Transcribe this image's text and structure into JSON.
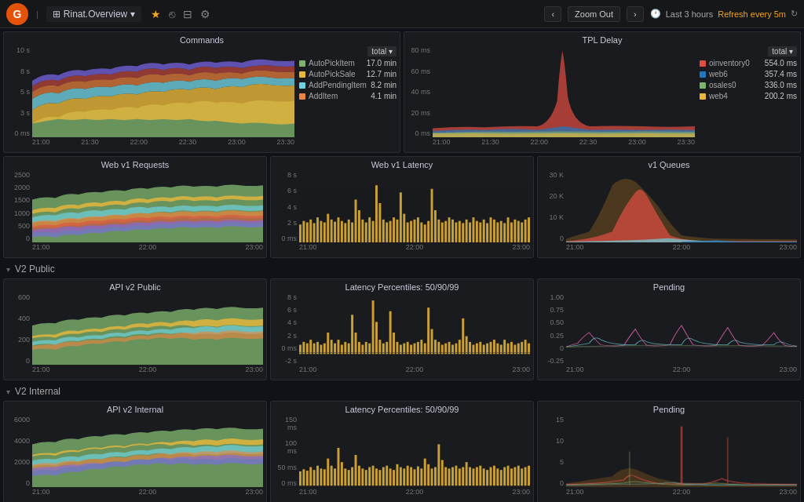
{
  "topnav": {
    "logo": "G",
    "dashboard_icon": "⊞",
    "dashboard_name": "Rinat.Overview",
    "dashboard_chevron": "▾",
    "star_icon": "★",
    "share_icon": "⎋",
    "save_icon": "💾",
    "settings_icon": "⚙",
    "nav_prev": "‹",
    "nav_next": "›",
    "zoom_out_label": "Zoom Out",
    "time_icon": "🕐",
    "time_label": "Last 3 hours",
    "refresh_label": "Refresh every 5m",
    "refresh_icon": "↻"
  },
  "sections": {
    "v2_public_label": "V2 Public",
    "v2_internal_label": "V2 Internal"
  },
  "panels": {
    "commands": {
      "title": "Commands",
      "legend_header": "total ▾",
      "items": [
        {
          "color": "#7eb26d",
          "name": "AutoPickItem",
          "val": "17.0 min"
        },
        {
          "color": "#eab839",
          "name": "AutoPickSale",
          "val": "12.7 min"
        },
        {
          "color": "#6ed0e0",
          "name": "AddPendingItem",
          "val": "8.2 min"
        },
        {
          "color": "#ef843c",
          "name": "AddItem",
          "val": "4.1 min"
        }
      ],
      "yaxis": [
        "10 s",
        "8 s",
        "5 s",
        "3 s",
        "0 ms"
      ],
      "xaxis": [
        "21:00",
        "21:30",
        "22:00",
        "22:30",
        "23:00",
        "23:30"
      ]
    },
    "tpl_delay": {
      "title": "TPL Delay",
      "legend_header": "total ▾",
      "items": [
        {
          "color": "#e24d42",
          "name": "oinventory0",
          "val": "554.0 ms"
        },
        {
          "color": "#1f78c1",
          "name": "web6",
          "val": "357.4 ms"
        },
        {
          "color": "#7eb26d",
          "name": "osales0",
          "val": "336.0 ms"
        },
        {
          "color": "#eab839",
          "name": "web4",
          "val": "200.2 ms"
        }
      ],
      "yaxis": [
        "80 ms",
        "60 ms",
        "40 ms",
        "20 ms",
        "0 ms"
      ],
      "xaxis": [
        "21:00",
        "21:30",
        "22:00",
        "22:30",
        "23:00",
        "23:30"
      ]
    },
    "web_v1_requests": {
      "title": "Web v1 Requests",
      "yaxis": [
        "2500",
        "2000",
        "1500",
        "1000",
        "500",
        "0"
      ],
      "xaxis": [
        "21:00",
        "22:00",
        "23:00"
      ]
    },
    "web_v1_latency": {
      "title": "Web v1 Latency",
      "yaxis": [
        "8 s",
        "6 s",
        "4 s",
        "2 s",
        "0 ms"
      ],
      "xaxis": [
        "21:00",
        "22:00",
        "23:00"
      ]
    },
    "v1_queues": {
      "title": "v1 Queues",
      "yaxis": [
        "30 K",
        "20 K",
        "10 K",
        "0"
      ],
      "xaxis": [
        "21:00",
        "22:00",
        "23:00"
      ]
    },
    "api_v2_public": {
      "title": "API v2 Public",
      "yaxis": [
        "600",
        "400",
        "200",
        "0"
      ],
      "xaxis": [
        "21:00",
        "22:00",
        "23:00"
      ]
    },
    "latency_pct_public": {
      "title": "Latency Percentiles: 50/90/99",
      "yaxis": [
        "8 s",
        "6 s",
        "4 s",
        "2 s",
        "0 ms",
        "-2 s"
      ],
      "xaxis": [
        "21:00",
        "22:00",
        "23:00"
      ]
    },
    "pending_public": {
      "title": "Pending",
      "yaxis": [
        "1.00",
        "0.75",
        "0.50",
        "0.25",
        "0",
        "-0.25"
      ],
      "xaxis": [
        "21:00",
        "22:00",
        "23:00"
      ]
    },
    "api_v2_internal": {
      "title": "API v2 Internal",
      "yaxis": [
        "6000",
        "4000",
        "2000",
        "0"
      ],
      "xaxis": [
        "21:00",
        "22:00",
        "23:00"
      ]
    },
    "latency_pct_internal": {
      "title": "Latency Percentiles: 50/90/99",
      "yaxis": [
        "150 ms",
        "100 ms",
        "50 ms",
        "0 ms"
      ],
      "xaxis": [
        "21:00",
        "22:00",
        "23:00"
      ]
    },
    "pending_internal": {
      "title": "Pending",
      "yaxis": [
        "15",
        "10",
        "5",
        "0"
      ],
      "xaxis": [
        "21:00",
        "22:00",
        "23:00"
      ]
    }
  },
  "colors": {
    "bg": "#111217",
    "panel_bg": "#1a1b1e",
    "border": "#2a2c30",
    "accent_orange": "#e5520a",
    "accent_yellow": "#f5a623",
    "green": "#7eb26d",
    "yellow": "#eab839",
    "blue": "#1f78c1",
    "cyan": "#6ed0e0",
    "orange": "#ef843c",
    "red": "#e24d42",
    "purple": "#7b68ee",
    "pink": "#e561b0"
  }
}
